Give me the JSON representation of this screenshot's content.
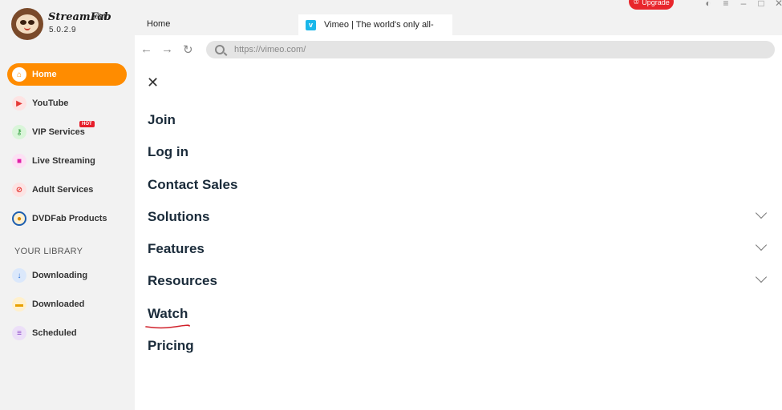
{
  "app": {
    "brand": "StreamFab",
    "arch": "x64",
    "version": "5.0.2.9"
  },
  "sidebar": {
    "items": [
      {
        "label": "Home",
        "icon": "home-icon",
        "active": true
      },
      {
        "label": "YouTube",
        "icon": "youtube-icon"
      },
      {
        "label": "VIP Services",
        "icon": "key-icon",
        "badge": "HOT"
      },
      {
        "label": "Live Streaming",
        "icon": "video-camera-icon"
      },
      {
        "label": "Adult Services",
        "icon": "eighteen-plus-icon"
      },
      {
        "label": "DVDFab Products",
        "icon": "dvdfab-icon"
      }
    ],
    "library_title": "YOUR LIBRARY",
    "library": [
      {
        "label": "Downloading",
        "icon": "download-arrow-icon"
      },
      {
        "label": "Downloaded",
        "icon": "folder-icon"
      },
      {
        "label": "Scheduled",
        "icon": "list-icon"
      }
    ]
  },
  "tabs": {
    "home": "Home",
    "vimeo": "Vimeo | The world's only all-",
    "vimeo_favicon": "v"
  },
  "header": {
    "upgrade": "Upgrade"
  },
  "address": {
    "url": "https://vimeo.com/"
  },
  "menu": {
    "items": [
      "Join",
      "Log in",
      "Contact Sales",
      "Solutions",
      "Features",
      "Resources",
      "Watch",
      "Pricing"
    ],
    "expandable": [
      "Solutions",
      "Features",
      "Resources"
    ],
    "annotated": "Watch"
  },
  "colors": {
    "accent": "#ff8c00",
    "upgrade": "#e8262c",
    "vimeo": "#1ab7ea",
    "annotation": "#d0202a"
  }
}
